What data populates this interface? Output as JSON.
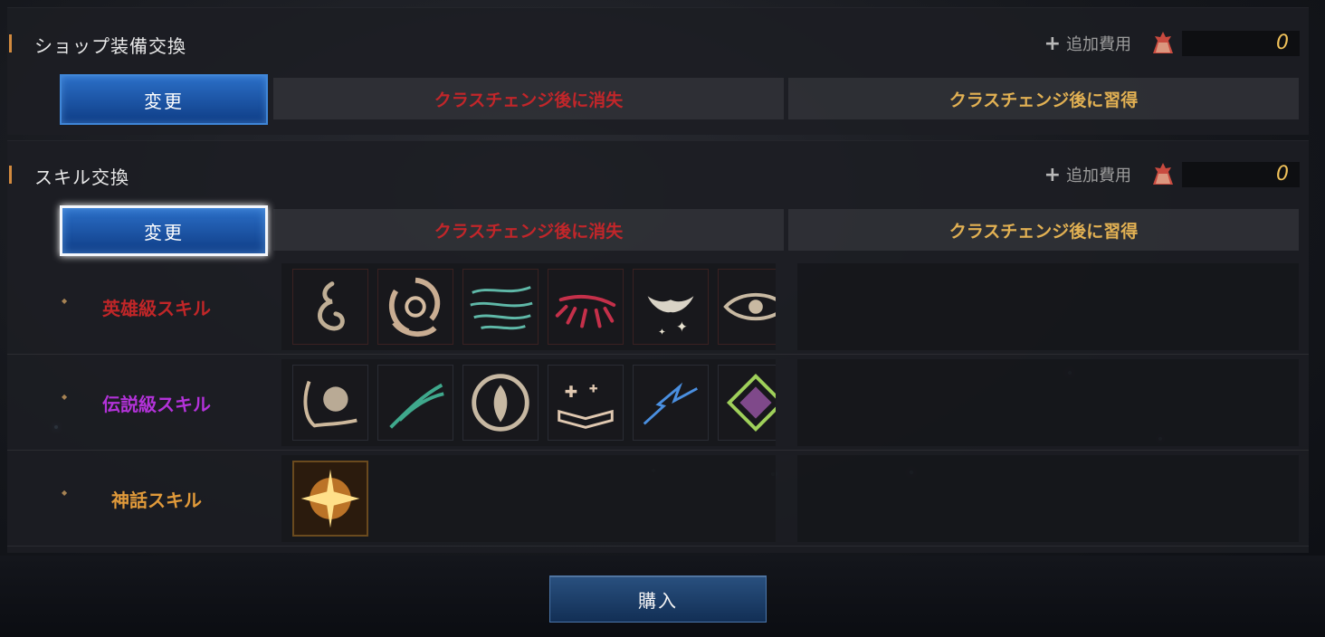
{
  "shop_section": {
    "title": "ショップ装備交換",
    "add_cost_label": "追加費用",
    "add_cost_value": "0",
    "change_button": "変更",
    "lose_label": "クラスチェンジ後に消失",
    "gain_label": "クラスチェンジ後に習得"
  },
  "skill_section": {
    "title": "スキル交換",
    "add_cost_label": "追加費用",
    "add_cost_value": "0",
    "change_button": "変更",
    "lose_label": "クラスチェンジ後に消失",
    "gain_label": "クラスチェンジ後に習得",
    "tiers": [
      {
        "label": "英雄級スキル",
        "color": "#c02628",
        "icons": [
          "flame-swirl-icon",
          "vortex-icon",
          "wind-lines-icon",
          "red-feather-icon",
          "holy-hands-icon",
          "eye-icon"
        ]
      },
      {
        "label": "伝説級スキル",
        "color": "#b332d9",
        "icons": [
          "claw-burst-icon",
          "wing-strike-icon",
          "shield-sigil-icon",
          "spellbook-icon",
          "lightning-wing-icon",
          "prism-crystal-icon"
        ]
      },
      {
        "label": "神話スキル",
        "color": "#e19a3a",
        "icons": [
          "golden-explosion-icon"
        ]
      }
    ]
  },
  "buy_button": "購入",
  "colors": {
    "accent_blue": "#2b6fc7",
    "cost_gold": "#f1c25a",
    "lose_red": "#c2262a",
    "gain_gold": "#e2b153"
  }
}
